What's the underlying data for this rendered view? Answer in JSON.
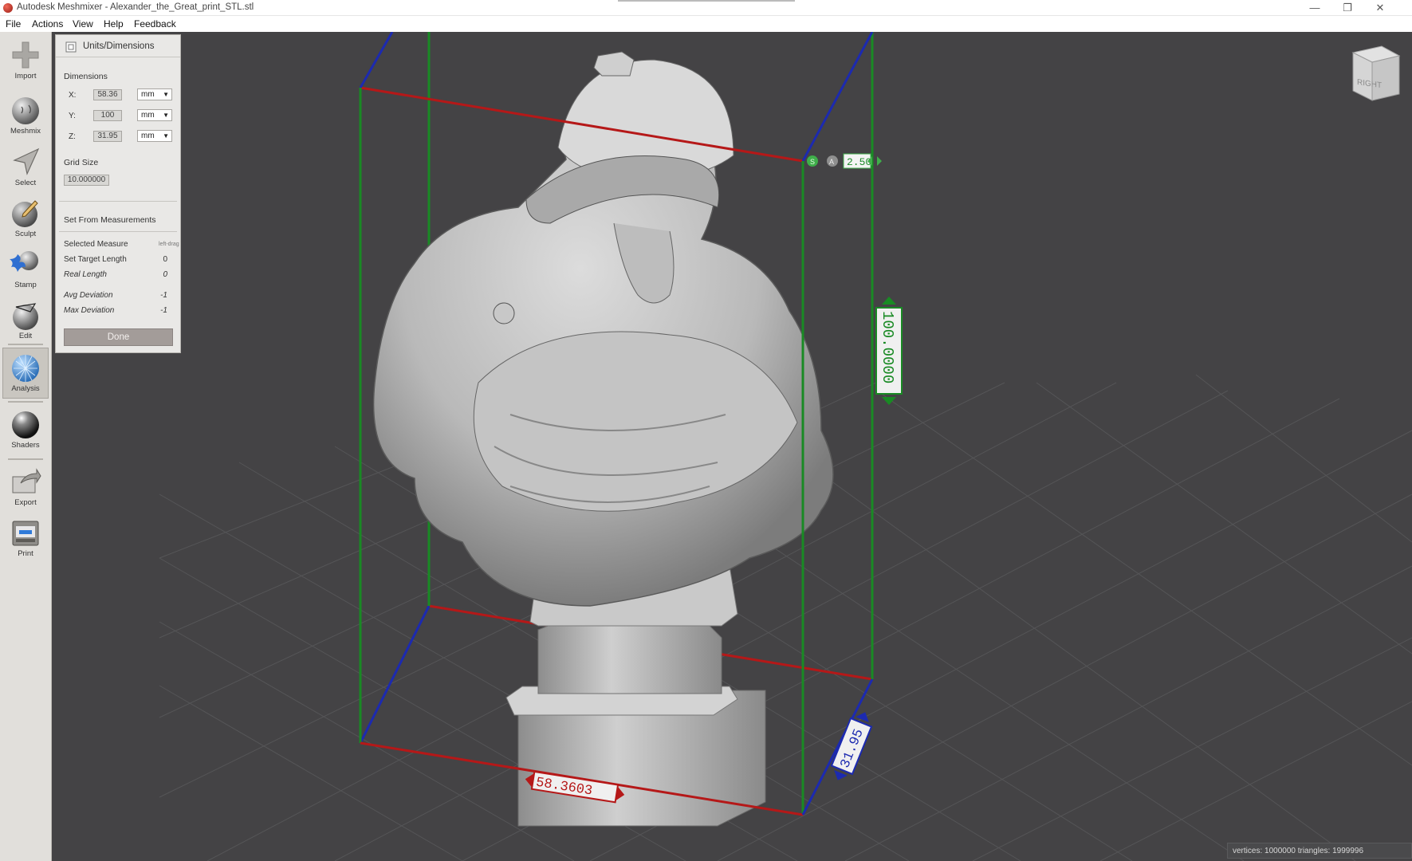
{
  "window": {
    "title": "Autodesk Meshmixer - Alexander_the_Great_print_STL.stl",
    "minimize": "—",
    "restore": "❐",
    "close": "✕"
  },
  "menu": [
    "File",
    "Actions",
    "View",
    "Help",
    "Feedback"
  ],
  "toolbar": {
    "tools": [
      {
        "label": "Import",
        "icon": "plus-icon"
      },
      {
        "label": "Meshmix",
        "icon": "meshmix-sphere-icon"
      },
      {
        "label": "Select",
        "icon": "select-arrow-icon"
      },
      {
        "label": "Sculpt",
        "icon": "sculpt-brush-icon"
      },
      {
        "label": "Stamp",
        "icon": "stamp-icon"
      },
      {
        "label": "Edit",
        "icon": "edit-sphere-icon"
      },
      {
        "label": "Analysis",
        "icon": "analysis-sphere-icon",
        "active": true
      },
      {
        "label": "Shaders",
        "icon": "shader-sphere-icon"
      },
      {
        "label": "Export",
        "icon": "export-icon"
      },
      {
        "label": "Print",
        "icon": "printer-icon"
      }
    ]
  },
  "panel": {
    "title": "Units/Dimensions",
    "dimensions_label": "Dimensions",
    "x_label": "X:",
    "x_value": "58.36",
    "y_label": "Y:",
    "y_value": "100",
    "z_label": "Z:",
    "z_value": "31.95",
    "unit": "mm",
    "grid_size_label": "Grid Size",
    "grid_size_value": "10.000000",
    "set_from_label": "Set From Measurements",
    "selected_measure_label": "Selected Measure",
    "selected_measure_value": "left-drag",
    "set_target_length_label": "Set Target Length",
    "set_target_length_value": "0",
    "real_length_label": "Real Length",
    "real_length_value": "0",
    "avg_deviation_label": "Avg Deviation",
    "avg_deviation_value": "-1",
    "max_deviation_label": "Max Deviation",
    "max_deviation_value": "-1",
    "done_label": "Done"
  },
  "viewport": {
    "gizmo_value": "2.50",
    "gizmo_s": "S",
    "gizmo_a": "A",
    "x_measure": "58.3603",
    "y_measure": "100.0000",
    "z_measure": "31.95",
    "viewcube_face": "RIGHT",
    "colors": {
      "x_axis": "#c01c1c",
      "y_axis": "#1f9a2a",
      "z_axis": "#1d2cc0",
      "background": "#444345"
    }
  },
  "status": {
    "text": "vertices: 1000000 triangles: 1999996"
  }
}
